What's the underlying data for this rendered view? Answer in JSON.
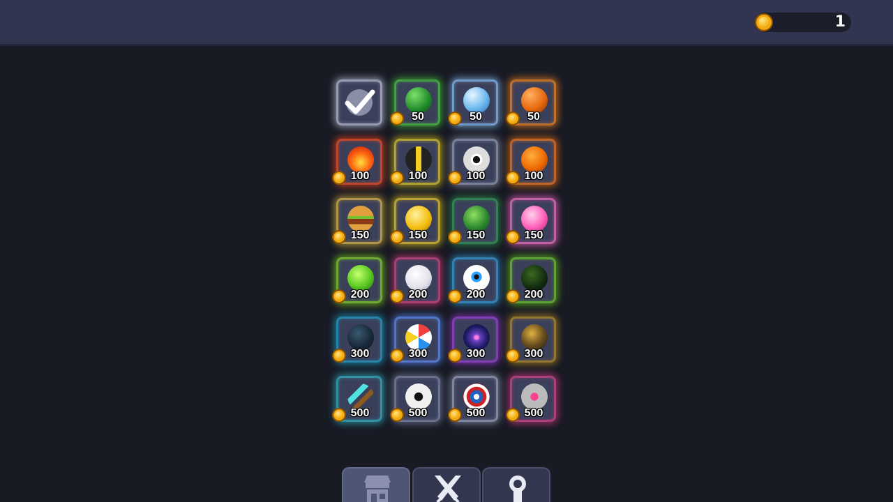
{
  "header": {
    "coins": "1",
    "coin_icon": "gold-coin-icon"
  },
  "shop": {
    "items": [
      {
        "id": "default",
        "icon": "checkmark-icon",
        "price": "",
        "owned": true,
        "glow": "#c7cbe0"
      },
      {
        "id": "watermelon",
        "icon": "watermelon-ball-icon",
        "price": "50",
        "glow": "#4bd13a"
      },
      {
        "id": "soccer",
        "icon": "blue-soccer-ball-icon",
        "price": "50",
        "glow": "#8fc8ff"
      },
      {
        "id": "basketball",
        "icon": "basketball-icon",
        "price": "50",
        "glow": "#ff8a1a"
      },
      {
        "id": "fire",
        "icon": "fire-ball-icon",
        "price": "100",
        "glow": "#ff4a1a"
      },
      {
        "id": "stripes",
        "icon": "black-yellow-ball-icon",
        "price": "100",
        "glow": "#e8d020"
      },
      {
        "id": "robot",
        "icon": "robot-eye-ball-icon",
        "price": "100",
        "glow": "#9aa0b8"
      },
      {
        "id": "pumpkin",
        "icon": "pumpkin-ball-icon",
        "price": "100",
        "glow": "#ff7a10"
      },
      {
        "id": "burger",
        "icon": "burger-ball-icon",
        "price": "150",
        "glow": "#e8c040"
      },
      {
        "id": "star",
        "icon": "gold-star-ball-icon",
        "price": "150",
        "glow": "#f4d020"
      },
      {
        "id": "turtle",
        "icon": "turtle-shell-ball-icon",
        "price": "150",
        "glow": "#2ea050"
      },
      {
        "id": "candy",
        "icon": "pink-candy-ball-icon",
        "price": "150",
        "glow": "#ff70c8"
      },
      {
        "id": "slime",
        "icon": "green-slime-ball-icon",
        "price": "200",
        "glow": "#88e020"
      },
      {
        "id": "ghost",
        "icon": "ghost-ball-icon",
        "price": "200",
        "glow": "#e04080"
      },
      {
        "id": "eyeball",
        "icon": "eyeball-icon",
        "price": "200",
        "glow": "#30a0e0"
      },
      {
        "id": "lava",
        "icon": "green-lava-ball-icon",
        "price": "200",
        "glow": "#70d020"
      },
      {
        "id": "tech",
        "icon": "cyan-tech-ball-icon",
        "price": "300",
        "glow": "#20a8d0"
      },
      {
        "id": "beach",
        "icon": "beach-ball-icon",
        "price": "300",
        "glow": "#6090ff"
      },
      {
        "id": "galaxy",
        "icon": "galaxy-ball-icon",
        "price": "300",
        "glow": "#a040e0"
      },
      {
        "id": "gold-camo",
        "icon": "gold-camo-ball-icon",
        "price": "300",
        "glow": "#c09020"
      },
      {
        "id": "pickaxe",
        "icon": "diamond-pickaxe-icon",
        "price": "500",
        "glow": "#30b8c8"
      },
      {
        "id": "spider",
        "icon": "spider-ball-icon",
        "price": "500",
        "glow": "#8088a8"
      },
      {
        "id": "shield",
        "icon": "captain-shield-icon",
        "price": "500",
        "glow": "#a0a8c0"
      },
      {
        "id": "heart-robot",
        "icon": "heart-robot-ball-icon",
        "price": "500",
        "glow": "#e0408a"
      }
    ]
  },
  "tabs": [
    {
      "icon": "shop-icon",
      "active": true
    },
    {
      "icon": "crossed-swords-icon",
      "active": false
    },
    {
      "icon": "award-ribbon-icon",
      "active": false
    }
  ]
}
